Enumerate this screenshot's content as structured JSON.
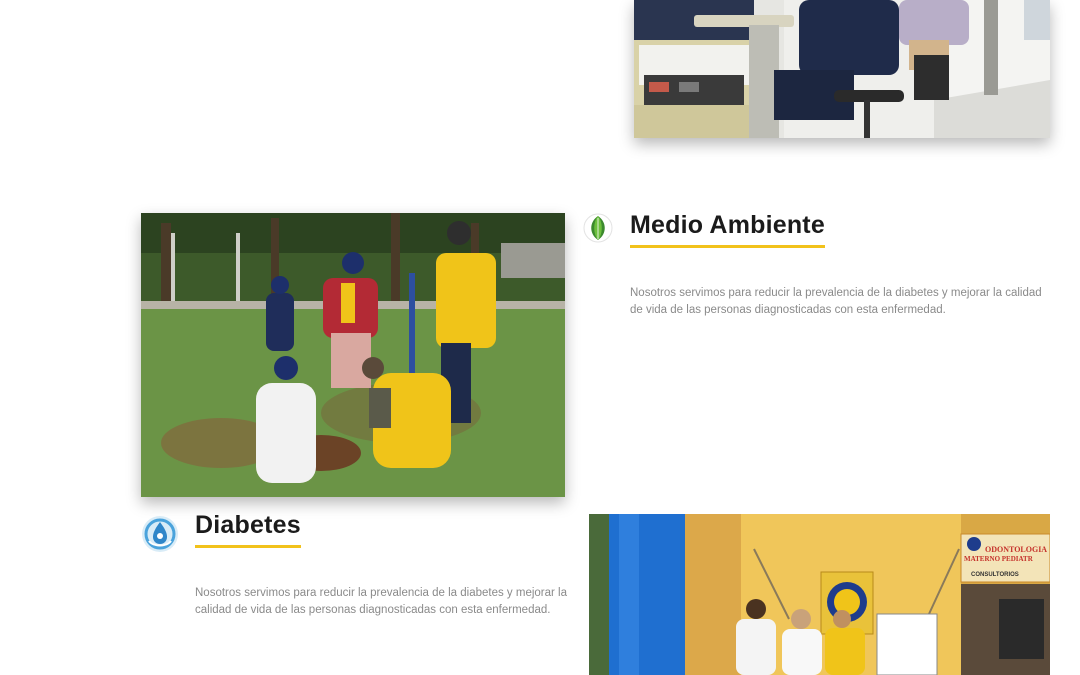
{
  "sections": [
    {
      "id": "medio-ambiente",
      "title": "Medio Ambiente",
      "icon": "leaf-icon",
      "description": "Nosotros servimos para reducir la prevalencia de la diabetes y mejorar la calidad de vida de las personas diagnosticadas con esta enfermedad."
    },
    {
      "id": "diabetes",
      "title": "Diabetes",
      "icon": "diabetes-drop-icon",
      "description": "Nosotros servimos para reducir la prevalencia de la diabetes y mejorar la calidad de vida de las personas diagnosticadas con esta enfermedad."
    }
  ],
  "photos": {
    "top": "dental-clinic-photo",
    "environment": "tree-planting-photo",
    "diabetes": "clinic-entrance-photo"
  },
  "signage": {
    "clinic_sign_line1": "ODONTOLOGIA",
    "clinic_sign_line2": "MATERNO PEDIATR",
    "clinic_sign_line3": "CONSULTORIOS"
  },
  "colors": {
    "accent": "#f2c21b",
    "title": "#1b1b1b",
    "body_text": "#8a8a8a"
  }
}
